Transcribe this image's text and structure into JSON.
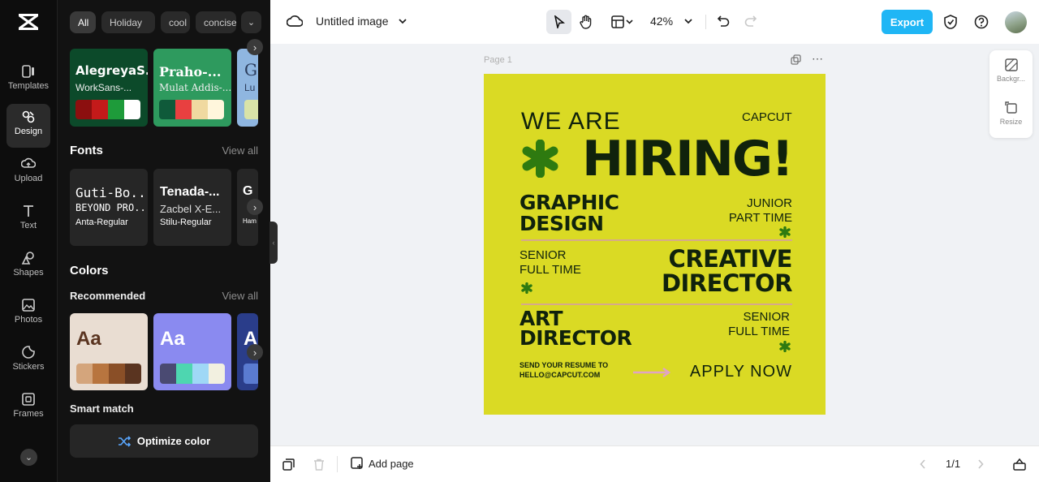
{
  "rail": {
    "items": [
      {
        "label": "Templates",
        "icon": "templates-icon"
      },
      {
        "label": "Design",
        "icon": "design-icon"
      },
      {
        "label": "Upload",
        "icon": "upload-icon"
      },
      {
        "label": "Text",
        "icon": "text-icon"
      },
      {
        "label": "Shapes",
        "icon": "shapes-icon"
      },
      {
        "label": "Photos",
        "icon": "photos-icon"
      },
      {
        "label": "Stickers",
        "icon": "stickers-icon"
      },
      {
        "label": "Frames",
        "icon": "frames-icon"
      }
    ]
  },
  "panel": {
    "chips": [
      "All",
      "Holiday",
      "cool",
      "concise"
    ],
    "font_combos": [
      {
        "title": "AlegreyaS...",
        "sub": "WorkSans-...",
        "colors": [
          "#8c0f0f",
          "#c41a1a",
          "#1e9b3a",
          "#ffffff"
        ],
        "bg": "#0c4a2a"
      },
      {
        "title": "Praho-...",
        "sub": "Mulat Addis-...",
        "colors": [
          "#0f5a3a",
          "#e84040",
          "#f0d9a0",
          "#fff6dc"
        ],
        "bg": "#2e9a5e"
      },
      {
        "title": "G",
        "sub": "Lu",
        "colors": [
          "#d9e3a8"
        ],
        "bg": "#8fb6e0"
      }
    ],
    "fonts_heading": "Fonts",
    "fonts_view_all": "View all",
    "fonts": [
      {
        "name": "Guti-Bo...",
        "line2": "BEYOND PRO...",
        "line3": "Anta-Regular"
      },
      {
        "name": "Tenada-...",
        "line2": "Zacbel X-E...",
        "line3": "Stilu-Regular"
      },
      {
        "name": "G",
        "line2": "",
        "line3": "Ham"
      }
    ],
    "colors_heading": "Colors",
    "recommended_label": "Recommended",
    "colors_view_all": "View all",
    "palettes": [
      {
        "aa": "Aa",
        "bg": "#e9ddd2",
        "fg": "#5a3420",
        "colors": [
          "#d4a57c",
          "#b8753f",
          "#8a4f27",
          "#5a3420"
        ]
      },
      {
        "aa": "Aa",
        "bg": "#8a8af0",
        "fg": "#ffffff",
        "colors": [
          "#4a4a72",
          "#4ed6b0",
          "#9fd8f6",
          "#f2f0e0"
        ]
      },
      {
        "aa": "A",
        "bg": "#2a3d8a",
        "fg": "#ffffff",
        "colors": [
          "#5a7bd0"
        ]
      }
    ],
    "smart_match_label": "Smart match",
    "optimize_label": "Optimize color"
  },
  "topbar": {
    "title": "Untitled image",
    "zoom": "42%",
    "export_label": "Export"
  },
  "page": {
    "label": "Page 1"
  },
  "side_tools": [
    {
      "label": "Backgr...",
      "icon": "background-icon"
    },
    {
      "label": "Resize",
      "icon": "resize-icon"
    }
  ],
  "poster": {
    "we_are": "WE ARE",
    "brand": "CAPCUT",
    "hiring": "HIRING!",
    "graphic": "GRAPHIC",
    "design": "DESIGN",
    "junior": "JUNIOR",
    "part_time": "PART TIME",
    "senior1": "SENIOR",
    "full_time1": "FULL TIME",
    "creative": "CREATIVE",
    "director1": "DIRECTOR",
    "art": "ART",
    "director2": "DIRECTOR",
    "senior2": "SENIOR",
    "full_time2": "FULL TIME",
    "send_line1": "SEND YOUR RESUME TO",
    "send_line2": "HELLO@CAPCUT.COM",
    "apply": "APPLY NOW",
    "accent_divider": "#d6a98c",
    "background": "#dada24"
  },
  "bottombar": {
    "add_page_label": "Add page",
    "page_count": "1/1"
  }
}
